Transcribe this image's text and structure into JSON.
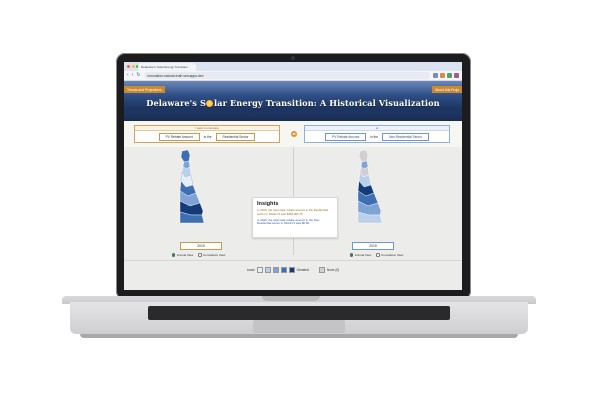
{
  "browser": {
    "tab_title": "Delaware's Solar Energy Transition",
    "url": "innovation-natural-truth.vercapps.dev"
  },
  "header": {
    "nav_left": "Trends and Projections",
    "nav_right": "About this Proje",
    "title_part1": "Delaware's S",
    "title_part2": "lar Energy Transition: A Historical Visualization"
  },
  "controls": {
    "left_heading": "I want to compare",
    "left_metric": "PV Rebate Amount",
    "left_connector": "in the",
    "left_sector": "Residential Sector",
    "right_heading": "to",
    "right_metric": "PV Rebate Amount",
    "right_connector": "in the",
    "right_sector": "Non-Residential Sector",
    "swap_icon": "swap-icon",
    "swap_glyph": "⇄"
  },
  "panels": {
    "left_year": "2015",
    "right_year": "2015",
    "view_annual": "Annual View",
    "view_cumulative": "Cumulative View",
    "selected_view": "Annual View"
  },
  "insights": {
    "title": "Insights",
    "residential_text": "In 2015, the total solar rebate amount in the Residential sector in District 9 was $463,300.75.",
    "nonresidential_text": "In 2015, the total solar rebate amount in the Non-Residential sector in District 9 was $0.00."
  },
  "legend": {
    "least_label": "Least",
    "greatest_label": "Greatest",
    "none_label": "None (0)",
    "colors": [
      "#e6eef8",
      "#b9cfea",
      "#7ea3d4",
      "#3f6fb3",
      "#143a78"
    ],
    "none_color": "#cfd0d2"
  },
  "colors": {
    "accent_gold": "#c9892f",
    "accent_blue": "#2c58a8",
    "header_dark": "#1c345f"
  }
}
